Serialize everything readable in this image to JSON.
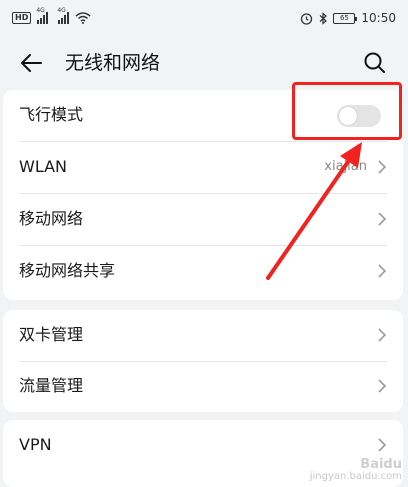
{
  "status_bar": {
    "hd_label": "HD",
    "net1": "4G",
    "net2": "4G",
    "battery": "65",
    "time": "10:50",
    "icons": [
      "alarm-icon",
      "bluetooth-icon",
      "wifi-icon"
    ]
  },
  "header": {
    "title": "无线和网络",
    "back_icon": "back-arrow-icon",
    "search_icon": "search-icon"
  },
  "groups": {
    "network": {
      "airplane": {
        "label": "飞行模式",
        "toggle_on": false
      },
      "wlan": {
        "label": "WLAN",
        "value": "xiajian"
      },
      "mobile": {
        "label": "移动网络"
      },
      "tethering": {
        "label": "移动网络共享"
      }
    },
    "sim": {
      "dual_sim": {
        "label": "双卡管理"
      },
      "data_usage": {
        "label": "流量管理"
      }
    },
    "vpn": {
      "label": "VPN"
    }
  },
  "annotation": {
    "highlight_color": "#f2231f",
    "note": "red box and arrow pointing at airplane mode toggle"
  },
  "watermark": {
    "line1": "Baidu",
    "line2": "jingyan.baidu.com"
  },
  "colors": {
    "background": "#f1f3f5",
    "card": "#ffffff",
    "toggle_off": "#e4e4e4",
    "annotation": "#f2231f"
  }
}
